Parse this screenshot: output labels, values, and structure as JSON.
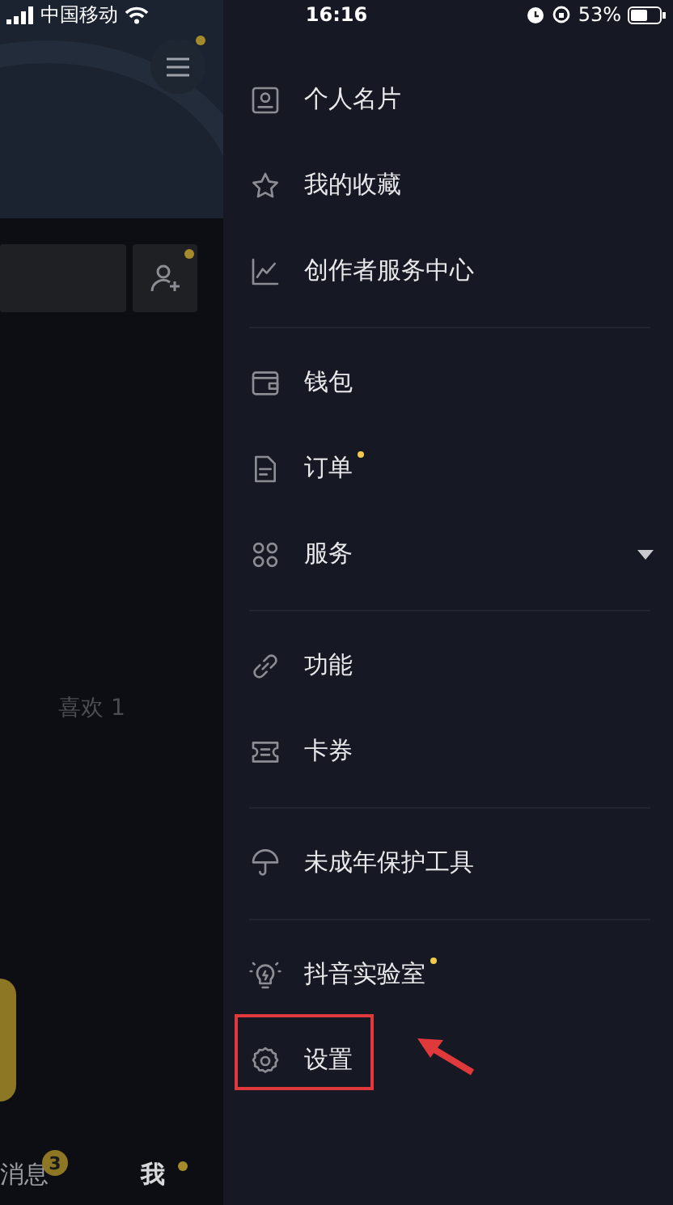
{
  "status_bar": {
    "carrier": "中国移动",
    "time": "16:16",
    "battery": "53%"
  },
  "background_page": {
    "menu_button": {
      "dot": true
    },
    "add_friend_button": {
      "dot": true
    },
    "tab": "喜欢 1",
    "bottom_nav": [
      {
        "label": "消息",
        "badge": "3",
        "dot": false
      },
      {
        "label": "我",
        "dot": true
      }
    ]
  },
  "drawer": {
    "groups": [
      {
        "items": [
          {
            "label": "个人名片",
            "dot": false,
            "expandable": false,
            "highlighted": false
          },
          {
            "label": "我的收藏",
            "dot": false,
            "expandable": false,
            "highlighted": false
          },
          {
            "label": "创作者服务中心",
            "dot": false,
            "expandable": false,
            "highlighted": false
          }
        ]
      },
      {
        "items": [
          {
            "label": "钱包",
            "dot": false,
            "expandable": false,
            "highlighted": false
          },
          {
            "label": "订单",
            "dot": true,
            "expandable": false,
            "highlighted": false
          },
          {
            "label": "服务",
            "dot": false,
            "expandable": true,
            "highlighted": false
          }
        ]
      },
      {
        "items": [
          {
            "label": "功能",
            "dot": false,
            "expandable": false,
            "highlighted": false
          },
          {
            "label": "卡券",
            "dot": false,
            "expandable": false,
            "highlighted": false
          }
        ]
      },
      {
        "items": [
          {
            "label": "未成年保护工具",
            "dot": false,
            "expandable": false,
            "highlighted": false
          }
        ]
      },
      {
        "items": [
          {
            "label": "抖音实验室",
            "dot": true,
            "expandable": false,
            "highlighted": false
          },
          {
            "label": "设置",
            "dot": false,
            "expandable": false,
            "highlighted": true
          }
        ]
      }
    ]
  }
}
